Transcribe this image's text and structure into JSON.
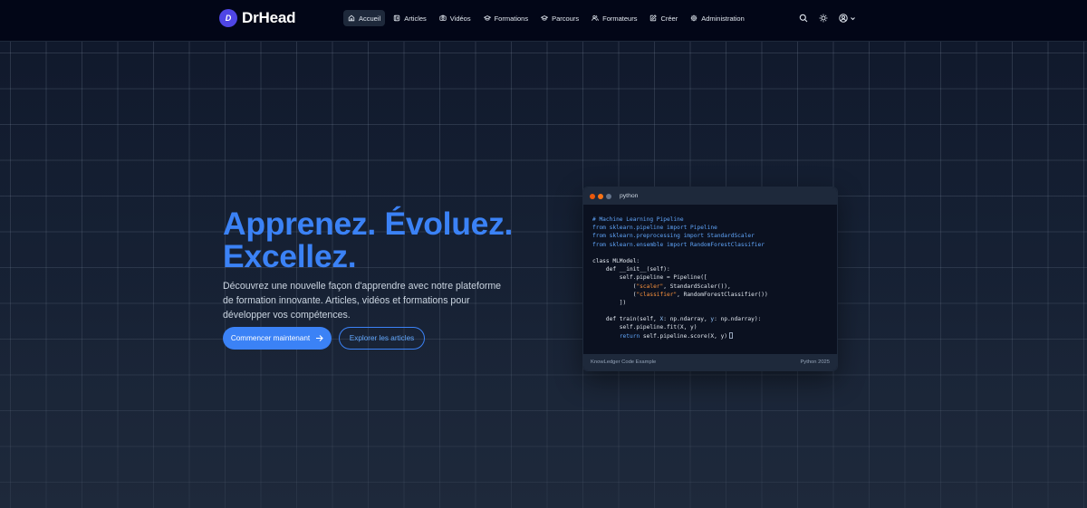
{
  "brand": {
    "name": "DrHead",
    "logo_letter": "D"
  },
  "nav": {
    "items": [
      {
        "label": "Accueil",
        "icon": "home-icon",
        "active": true
      },
      {
        "label": "Articles",
        "icon": "book-icon",
        "active": false
      },
      {
        "label": "Vidéos",
        "icon": "video-icon",
        "active": false
      },
      {
        "label": "Formations",
        "icon": "graduation-cap-icon",
        "active": false
      },
      {
        "label": "Parcours",
        "icon": "graduation-cap-icon",
        "active": false
      },
      {
        "label": "Formateurs",
        "icon": "users-icon",
        "active": false
      },
      {
        "label": "Créer",
        "icon": "edit-icon",
        "active": false
      },
      {
        "label": "Administration",
        "icon": "gear-icon",
        "active": false
      }
    ],
    "right_icons": [
      "search-icon",
      "sun-icon",
      "user-circle-icon",
      "chevron-down-icon"
    ]
  },
  "hero": {
    "title_lines": [
      "Apprenez. Évoluez.",
      "Excellez."
    ],
    "description": "Découvrez une nouvelle façon d'apprendre avec notre plateforme de formation innovante. Articles, vidéos et formations pour développer vos compétences.",
    "primary_button": "Commencer maintenant",
    "secondary_button": "Explorer les articles"
  },
  "code_window": {
    "language": "python",
    "lines": [
      "# Machine Learning Pipeline",
      "from sklearn.pipeline import Pipeline",
      "from sklearn.preprocessing import StandardScaler",
      "from sklearn.ensemble import RandomForestClassifier",
      "",
      "class MLModel:",
      "    def __init__(self):",
      "        self.pipeline = Pipeline([",
      "            (\"scaler\", StandardScaler()),",
      "            (\"classifier\", RandomForestClassifier())",
      "        ])",
      "",
      "    def train(self, X: np.ndarray, y: np.ndarray):",
      "        self.pipeline.fit(X, y)",
      "        return self.pipeline.score(X, y)"
    ],
    "footer_left": "KnowLedger Code Example",
    "footer_right": "Python 2025"
  },
  "colors": {
    "accent": "#3b82f6",
    "brand_logo": "#4f46e5",
    "navbar_bg": "#020617",
    "page_bg": "#0f172a",
    "dot_red": "#ea580c",
    "dot_orange": "#f97316",
    "dot_gray": "#64748b"
  }
}
